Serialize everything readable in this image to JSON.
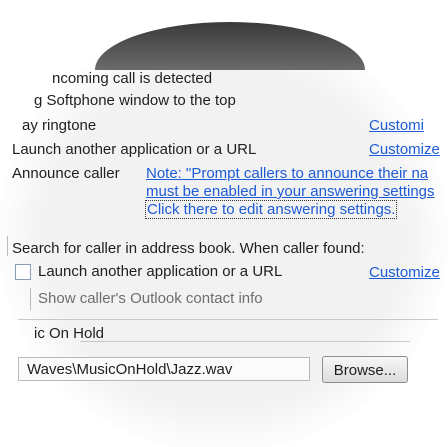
{
  "rows": {
    "incoming": "ncoming call is detected",
    "softphone": "g Softphone window to the top",
    "ringtone": "ay ringtone",
    "launch1": "Launch another application or a URL",
    "announce": "Announce caller",
    "search_label": "Search for caller in address book. When caller found:",
    "launch2": "Launch another application or a URL",
    "outlook": "Show caller's Outlook contact info",
    "music_group": "ic On Hold"
  },
  "links": {
    "customize_ringtone": "Customi",
    "customize_launch1": "Customize",
    "note_line1": "Note: \"Prompt callers to announce their na",
    "note_line2": "must be enabled in your answering settings",
    "note_line3": "Click there to edit answering settings.",
    "customize_launch2": "Customize"
  },
  "music": {
    "path": "Waves\\MusicOnHold\\Jazz.wav",
    "browse_label": "Browse..."
  },
  "colors": {
    "link": "#1e5bd6",
    "muted_text": "#6e6e6e"
  }
}
